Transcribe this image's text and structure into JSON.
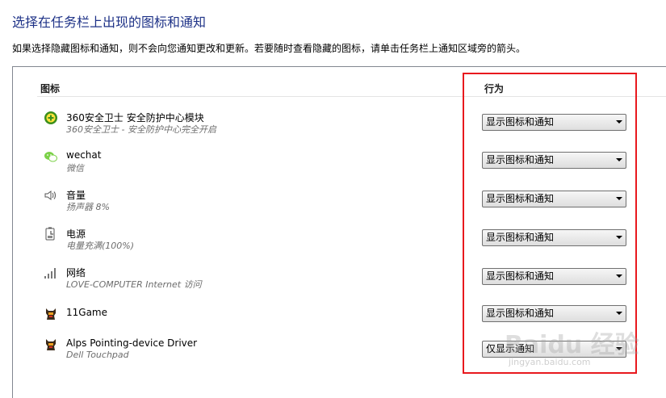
{
  "page": {
    "title": "选择在任务栏上出现的图标和通知",
    "description": "如果选择隐藏图标和通知，则不会向您通知更改和更新。若要随时查看隐藏的图标，请单击任务栏上通知区域旁的箭头。"
  },
  "table": {
    "col_icon_header": "图标",
    "col_behavior_header": "行为",
    "rows": [
      {
        "name": "360安全卫士 安全防护中心模块",
        "subtitle": "360安全卫士 - 安全防护中心完全开启",
        "behavior": "显示图标和通知",
        "icon": "shield-360-icon"
      },
      {
        "name": "wechat",
        "subtitle": "微信",
        "behavior": "显示图标和通知",
        "icon": "wechat-icon"
      },
      {
        "name": "音量",
        "subtitle": "扬声器 8%",
        "behavior": "显示图标和通知",
        "icon": "speaker-icon"
      },
      {
        "name": "电源",
        "subtitle": "电量充满(100%)",
        "behavior": "显示图标和通知",
        "icon": "battery-icon"
      },
      {
        "name": "网络",
        "subtitle": "LOVE-COMPUTER Internet 访问",
        "behavior": "显示图标和通知",
        "icon": "network-signal-icon"
      },
      {
        "name": "11Game",
        "subtitle": "",
        "behavior": "显示图标和通知",
        "icon": "game-11-icon"
      },
      {
        "name": "Alps Pointing-device Driver",
        "subtitle": "Dell Touchpad",
        "behavior": "仅显示通知",
        "icon": "touchpad-icon"
      }
    ]
  },
  "watermark": {
    "text": "Baidu 经验",
    "url": "jingyan.baidu.com"
  },
  "colors": {
    "title": "#1e3287",
    "highlight_border": "#e8191e",
    "subtitle": "#6d6d6d"
  }
}
